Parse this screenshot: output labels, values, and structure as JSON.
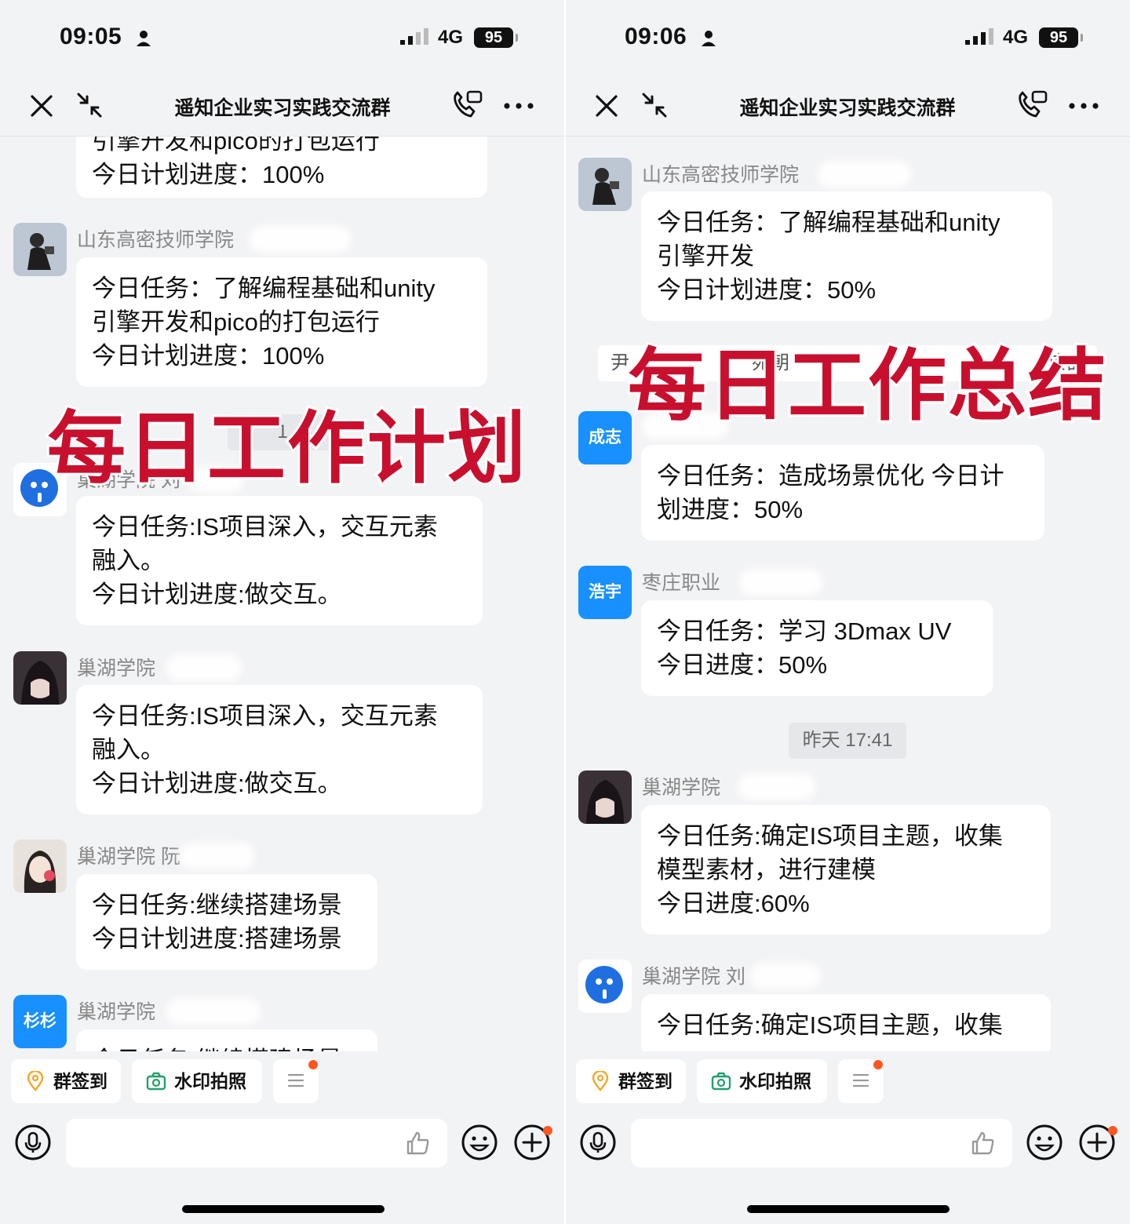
{
  "left": {
    "status": {
      "time": "09:05",
      "network": "4G",
      "battery": "95"
    },
    "header": {
      "title": "遥知企业实习实践交流群"
    },
    "top_partial": {
      "line1": "引擎开发和pico的打包运行",
      "line2": "今日计划进度：100%"
    },
    "messages": [
      {
        "sender": "山东高密技师学院",
        "lines": [
          "今日任务：了解编程基础和unity",
          "引擎开发和pico的打包运行",
          "今日计划进度：100%"
        ]
      },
      {
        "sender": "巢湖学院  刘",
        "lines": [
          "今日任务:IS项目深入，交互元素",
          "融入。",
          "今日计划进度:做交互。"
        ]
      },
      {
        "sender": "巢湖学院",
        "lines": [
          "今日任务:IS项目深入，交互元素",
          "融入。",
          "今日计划进度:做交互。"
        ]
      },
      {
        "sender": "巢湖学院  阮",
        "lines": [
          "今日任务:继续搭建场景",
          "今日计划进度:搭建场景"
        ]
      },
      {
        "sender": "巢湖学院",
        "avatar_text": "杉杉",
        "lines": [
          "今日任务:继续搭建场景"
        ]
      }
    ],
    "time_chip": "1",
    "overlay": "每日工作计划"
  },
  "right": {
    "status": {
      "time": "09:06",
      "network": "4G",
      "battery": "95"
    },
    "header": {
      "title": "遥知企业实习实践交流群"
    },
    "messages": [
      {
        "sender": "山东高密技师学院",
        "lines": [
          "今日任务：了解编程基础和unity",
          "引擎开发",
          "今日计划进度：50%"
        ]
      },
      {
        "sender": "王成志",
        "avatar_text": "成志",
        "lines": [
          "今日任务：造成场景优化 今日计",
          "划进度：50%"
        ]
      },
      {
        "sender": "枣庄职业",
        "avatar_text": "浩宇",
        "lines": [
          "今日任务：学习 3Dmax UV",
          "今日进度：50%"
        ]
      },
      {
        "sender": "巢湖学院",
        "lines": [
          "今日任务:确定IS项目主题，收集",
          "模型素材，进行建模",
          "今日进度:60%"
        ]
      },
      {
        "sender": "巢湖学院  刘",
        "lines": [
          "今日任务:确定IS项目主题，收集"
        ]
      }
    ],
    "system_notice": {
      "left": "尹",
      "mid": "宛朝",
      "right": "该群"
    },
    "time_chip": "昨天 17:41",
    "overlay": "每日工作总结"
  },
  "quick_actions": {
    "checkin": "群签到",
    "watermark": "水印拍照"
  },
  "icons": {
    "close": "close-icon",
    "shrink": "shrink-icon",
    "call": "phone-call-icon",
    "more": "more-icon",
    "voice": "microphone-icon",
    "emoji": "emoji-icon",
    "plus": "plus-icon",
    "like": "thumbs-up-icon",
    "checkin": "location-icon",
    "watermark": "camera-icon",
    "menu": "menu-icon"
  },
  "colors": {
    "accent": "#1890ff",
    "overlay": "#c8102e",
    "notify_dot": "#ff5722",
    "background": "#f2f3f5"
  }
}
